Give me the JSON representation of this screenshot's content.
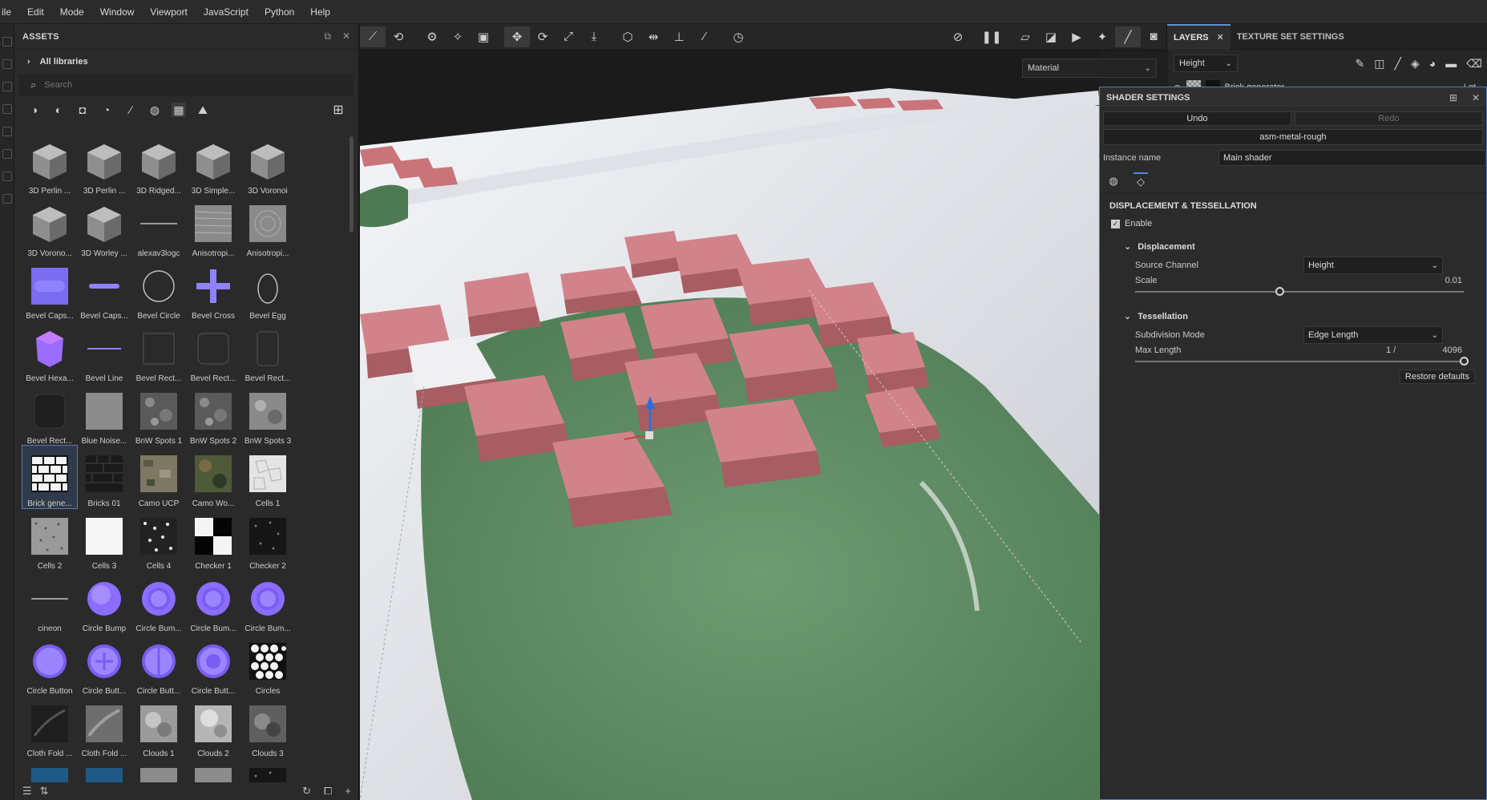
{
  "menu": [
    "ile",
    "Edit",
    "Mode",
    "Window",
    "Viewport",
    "JavaScript",
    "Python",
    "Help"
  ],
  "assets": {
    "title": "ASSETS",
    "library": "All libraries",
    "search_placeholder": "Search",
    "items": [
      {
        "label": "3D Perlin ...",
        "kind": "cube"
      },
      {
        "label": "3D Perlin ...",
        "kind": "cube"
      },
      {
        "label": "3D Ridged...",
        "kind": "cube"
      },
      {
        "label": "3D Simple...",
        "kind": "cube"
      },
      {
        "label": "3D Voronoi",
        "kind": "cube"
      },
      {
        "label": "3D Vorono...",
        "kind": "cube"
      },
      {
        "label": "3D Worley ...",
        "kind": "cube"
      },
      {
        "label": "alexav3logc",
        "kind": "line"
      },
      {
        "label": "Anisotropi...",
        "kind": "brushed"
      },
      {
        "label": "Anisotropi...",
        "kind": "swirl"
      },
      {
        "label": "Bevel Caps...",
        "kind": "purple-square"
      },
      {
        "label": "Bevel Caps...",
        "kind": "purple-line"
      },
      {
        "label": "Bevel Circle",
        "kind": "circle-outline"
      },
      {
        "label": "Bevel Cross",
        "kind": "cross"
      },
      {
        "label": "Bevel Egg",
        "kind": "egg-outline"
      },
      {
        "label": "Bevel Hexa...",
        "kind": "hexagon"
      },
      {
        "label": "Bevel Line",
        "kind": "thin-line"
      },
      {
        "label": "Bevel Rect...",
        "kind": "rect-outline"
      },
      {
        "label": "Bevel Rect...",
        "kind": "rect-round"
      },
      {
        "label": "Bevel Rect...",
        "kind": "rect-tall"
      },
      {
        "label": "Bevel Rect...",
        "kind": "rect-dark"
      },
      {
        "label": "Blue Noise...",
        "kind": "gray"
      },
      {
        "label": "BnW Spots 1",
        "kind": "noise"
      },
      {
        "label": "BnW Spots 2",
        "kind": "noise"
      },
      {
        "label": "BnW Spots 3",
        "kind": "noise-light"
      },
      {
        "label": "Brick gene...",
        "kind": "brick-white",
        "selected": true
      },
      {
        "label": "Bricks 01",
        "kind": "brick-dark"
      },
      {
        "label": "Camo UCP",
        "kind": "camo"
      },
      {
        "label": "Camo Wo...",
        "kind": "camo-green"
      },
      {
        "label": "Cells 1",
        "kind": "cells-white"
      },
      {
        "label": "Cells 2",
        "kind": "speckle"
      },
      {
        "label": "Cells 3",
        "kind": "white"
      },
      {
        "label": "Cells 4",
        "kind": "speckle-bw"
      },
      {
        "label": "Checker 1",
        "kind": "checker"
      },
      {
        "label": "Checker 2",
        "kind": "speckle-dark"
      },
      {
        "label": "cineon",
        "kind": "line"
      },
      {
        "label": "Circle Bump",
        "kind": "bump"
      },
      {
        "label": "Circle Bum...",
        "kind": "bump-ring"
      },
      {
        "label": "Circle Bum...",
        "kind": "bump-ring"
      },
      {
        "label": "Circle Bum...",
        "kind": "bump-ring"
      },
      {
        "label": "Circle Button",
        "kind": "button"
      },
      {
        "label": "Circle Butt...",
        "kind": "button-cross"
      },
      {
        "label": "Circle Butt...",
        "kind": "button-split"
      },
      {
        "label": "Circle Butt...",
        "kind": "button-ring"
      },
      {
        "label": "Circles",
        "kind": "circles"
      },
      {
        "label": "Cloth Fold ...",
        "kind": "cloth-dark"
      },
      {
        "label": "Cloth Fold ...",
        "kind": "cloth"
      },
      {
        "label": "Clouds 1",
        "kind": "clouds"
      },
      {
        "label": "Clouds 2",
        "kind": "clouds-light"
      },
      {
        "label": "Clouds 3",
        "kind": "clouds-dark"
      },
      {
        "label": "",
        "kind": "blue"
      },
      {
        "label": "",
        "kind": "blue"
      },
      {
        "label": "",
        "kind": "gray"
      },
      {
        "label": "",
        "kind": "gray"
      },
      {
        "label": "",
        "kind": "speckle-dark"
      }
    ]
  },
  "viewport": {
    "material_select": "Material"
  },
  "layers": {
    "tab_layers": "LAYERS",
    "tab_texture_set": "TEXTURE SET SETTINGS",
    "channel_select": "Height",
    "layer_name": "Brick generator",
    "layer_blend": "Lgt"
  },
  "shader": {
    "title": "SHADER SETTINGS",
    "undo": "Undo",
    "redo": "Redo",
    "shader_name": "asm-metal-rough",
    "instance_label": "Instance name",
    "instance_value": "Main shader",
    "section": "DISPLACEMENT & TESSELLATION",
    "enable_label": "Enable",
    "enable_checked": true,
    "displacement": {
      "title": "Displacement",
      "source_channel_label": "Source Channel",
      "source_channel_value": "Height",
      "scale_label": "Scale",
      "scale_value": "0.01",
      "scale_fraction": 0.44
    },
    "tessellation": {
      "title": "Tessellation",
      "subdivision_label": "Subdivision Mode",
      "subdivision_value": "Edge Length",
      "max_length_label": "Max Length",
      "max_length_mid": "1 /",
      "max_length_value": "4096",
      "max_length_fraction": 1.0
    },
    "restore": "Restore defaults"
  },
  "colors": {
    "accent": "#4f86d8",
    "brick": "#c87479",
    "ground": "#5d8a62"
  }
}
